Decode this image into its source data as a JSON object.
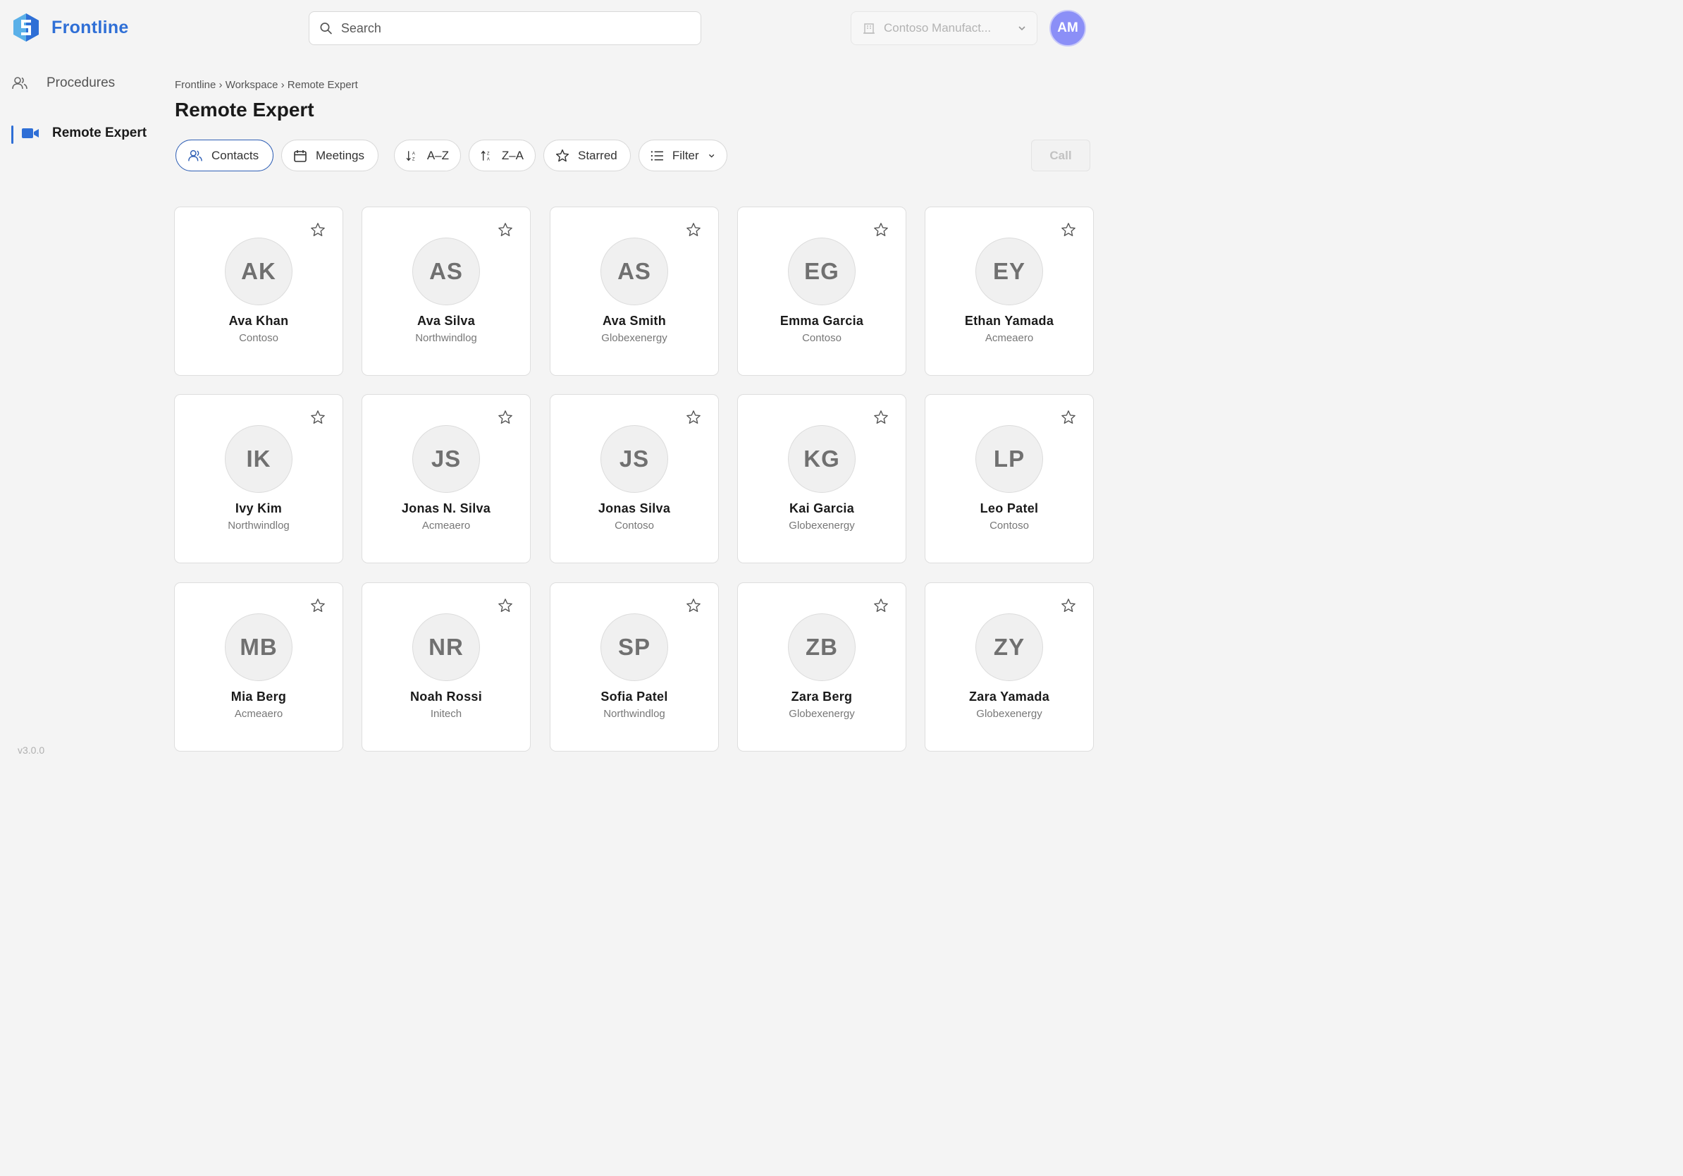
{
  "brand": {
    "name": "Frontline"
  },
  "search": {
    "placeholder": "Search"
  },
  "org_select": {
    "value": "Contoso Manufact..."
  },
  "user": {
    "initials": "AM"
  },
  "sidebar": {
    "items": [
      {
        "label": "Procedures",
        "active": false,
        "icon": "people-icon"
      },
      {
        "label": "Remote Expert",
        "active": true,
        "icon": "video-camera-icon"
      }
    ]
  },
  "version": "v3.0.0",
  "breadcrumb": "Frontline › Workspace › Remote Expert",
  "page_title": "Remote Expert",
  "toolbar": {
    "contacts": "Contacts",
    "meetings": "Meetings",
    "sort_az": "A–Z",
    "sort_za": "Z–A",
    "starred": "Starred",
    "filter": "Filter",
    "call": "Call"
  },
  "colors": {
    "accent": "#2f6fd6",
    "avatar": "#8b8ff7"
  },
  "contacts": [
    {
      "initials": "AK",
      "name": "Ava Khan",
      "org": "Contoso"
    },
    {
      "initials": "AS",
      "name": "Ava Silva",
      "org": "Northwindlog"
    },
    {
      "initials": "AS",
      "name": "Ava Smith",
      "org": "Globexenergy"
    },
    {
      "initials": "EG",
      "name": "Emma Garcia",
      "org": "Contoso"
    },
    {
      "initials": "EY",
      "name": "Ethan Yamada",
      "org": "Acmeaero"
    },
    {
      "initials": "IK",
      "name": "Ivy Kim",
      "org": "Northwindlog"
    },
    {
      "initials": "JS",
      "name": "Jonas N. Silva",
      "org": "Acmeaero"
    },
    {
      "initials": "JS",
      "name": "Jonas Silva",
      "org": "Contoso"
    },
    {
      "initials": "KG",
      "name": "Kai Garcia",
      "org": "Globexenergy"
    },
    {
      "initials": "LP",
      "name": "Leo Patel",
      "org": "Contoso"
    },
    {
      "initials": "MB",
      "name": "Mia Berg",
      "org": "Acmeaero"
    },
    {
      "initials": "NR",
      "name": "Noah Rossi",
      "org": "Initech"
    },
    {
      "initials": "SP",
      "name": "Sofia Patel",
      "org": "Northwindlog"
    },
    {
      "initials": "ZB",
      "name": "Zara Berg",
      "org": "Globexenergy"
    },
    {
      "initials": "ZY",
      "name": "Zara Yamada",
      "org": "Globexenergy"
    }
  ]
}
